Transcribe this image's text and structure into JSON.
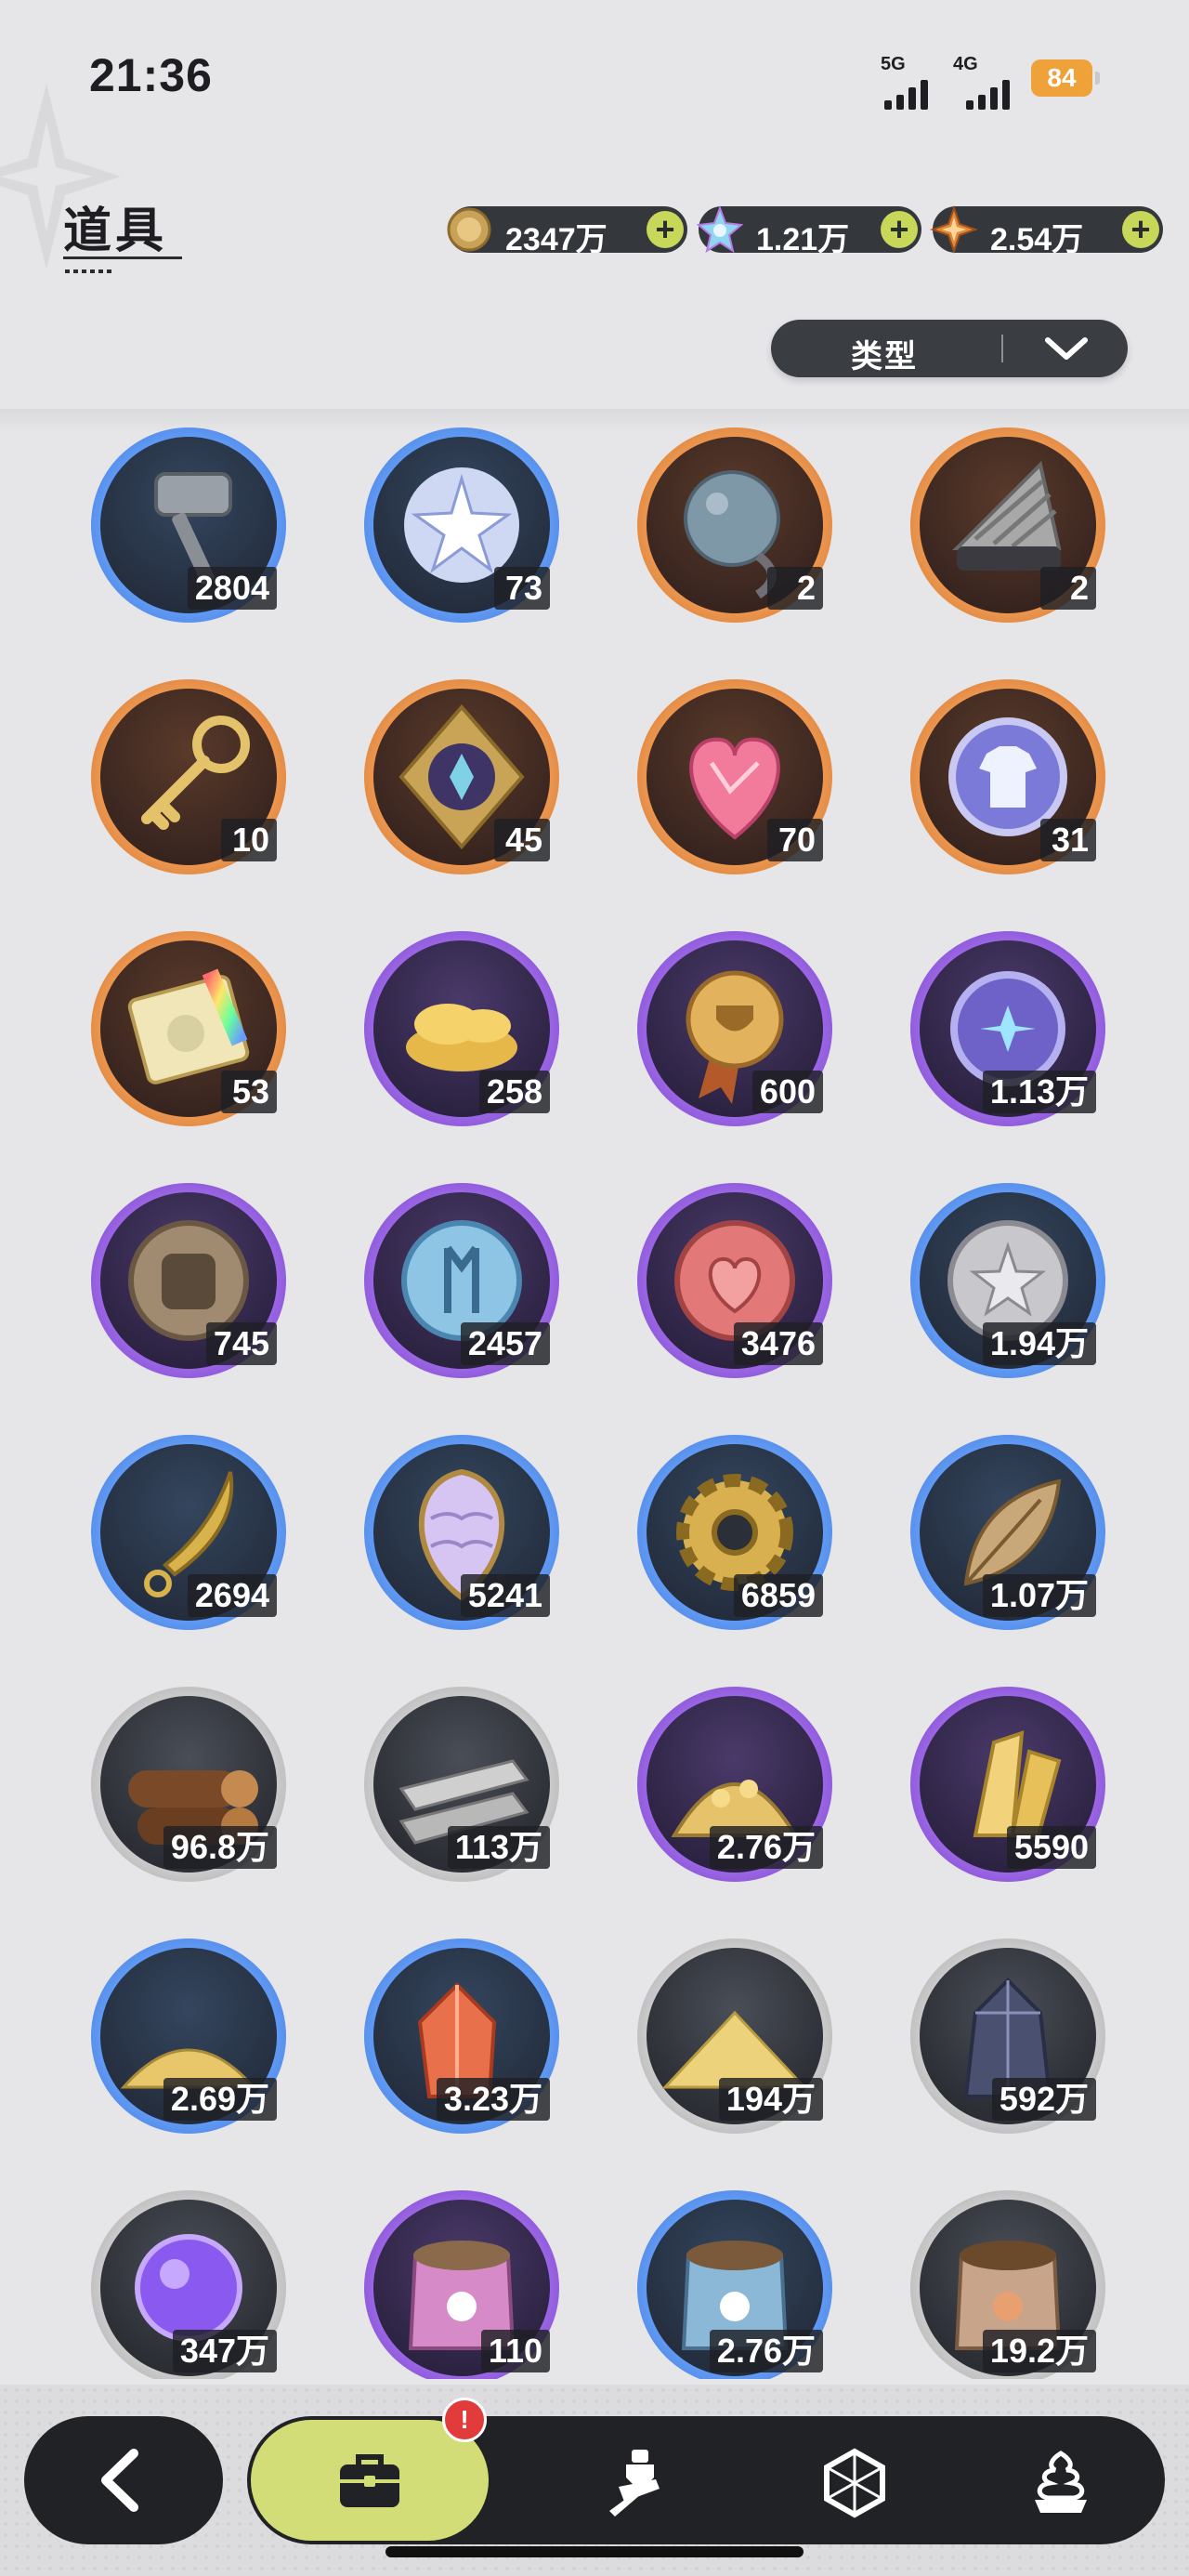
{
  "status_bar": {
    "time": "21:36",
    "sig1": "5G",
    "sig2": "4G",
    "battery": "84"
  },
  "header": {
    "title": "道具",
    "currencies": [
      {
        "icon": "gold-coin-icon",
        "value": "2347万",
        "add": "+"
      },
      {
        "icon": "crystal-icon",
        "value": "1.21万",
        "add": "+"
      },
      {
        "icon": "star-gem-icon",
        "value": "2.54万",
        "add": "+"
      }
    ],
    "filter_label": "类型"
  },
  "items": [
    {
      "icon": "hammer-icon",
      "rarity": "blue",
      "count": "2804"
    },
    {
      "icon": "star-orb-icon",
      "rarity": "blue",
      "count": "73"
    },
    {
      "icon": "spiked-ball-icon",
      "rarity": "orange",
      "count": "2"
    },
    {
      "icon": "drill-icon",
      "rarity": "orange",
      "count": "2"
    },
    {
      "icon": "key-icon",
      "rarity": "orange",
      "count": "10"
    },
    {
      "icon": "emblem-icon",
      "rarity": "orange",
      "count": "45"
    },
    {
      "icon": "heart-gem-icon",
      "rarity": "orange",
      "count": "70"
    },
    {
      "icon": "shirt-coin-icon",
      "rarity": "orange",
      "count": "31"
    },
    {
      "icon": "ticket-icon",
      "rarity": "orange",
      "count": "53"
    },
    {
      "icon": "gold-ingot-icon",
      "rarity": "purple",
      "count": "258"
    },
    {
      "icon": "medal-icon",
      "rarity": "purple",
      "count": "600"
    },
    {
      "icon": "moon-coin-icon",
      "rarity": "purple",
      "count": "1.13万"
    },
    {
      "icon": "fist-coin-icon",
      "rarity": "purple",
      "count": "745"
    },
    {
      "icon": "blue-coin-icon",
      "rarity": "purple",
      "count": "2457"
    },
    {
      "icon": "heart-coin-icon",
      "rarity": "purple",
      "count": "3476"
    },
    {
      "icon": "silver-coin-icon",
      "rarity": "blue",
      "count": "1.94万"
    },
    {
      "icon": "blade-icon",
      "rarity": "blue",
      "count": "2694"
    },
    {
      "icon": "scale-icon",
      "rarity": "blue",
      "count": "5241"
    },
    {
      "icon": "gear-icon",
      "rarity": "blue",
      "count": "6859"
    },
    {
      "icon": "leaf-icon",
      "rarity": "blue",
      "count": "1.07万"
    },
    {
      "icon": "wood-icon",
      "rarity": "gray",
      "count": "96.8万"
    },
    {
      "icon": "stone-icon",
      "rarity": "gray",
      "count": "113万"
    },
    {
      "icon": "gold-ore-icon",
      "rarity": "purple",
      "count": "2.76万"
    },
    {
      "icon": "crystal-shard-icon",
      "rarity": "purple",
      "count": "5590"
    },
    {
      "icon": "gold-sand-icon",
      "rarity": "blue",
      "count": "2.69万"
    },
    {
      "icon": "red-crystal-icon",
      "rarity": "blue",
      "count": "3.23万"
    },
    {
      "icon": "sand-pile-icon",
      "rarity": "gray",
      "count": "194万"
    },
    {
      "icon": "dark-crystal-icon",
      "rarity": "gray",
      "count": "592万"
    },
    {
      "icon": "purple-orb-icon",
      "rarity": "gray",
      "count": "347万"
    },
    {
      "icon": "pink-food-bag-icon",
      "rarity": "purple",
      "count": "110"
    },
    {
      "icon": "blue-food-bag-icon",
      "rarity": "blue",
      "count": "2.76万"
    },
    {
      "icon": "brown-food-bag-icon",
      "rarity": "gray",
      "count": "19.2万"
    }
  ],
  "bottom_nav": {
    "badge": "!",
    "tabs": [
      "bag-icon",
      "knight-icon",
      "hexagon-icon",
      "dessert-icon"
    ]
  }
}
